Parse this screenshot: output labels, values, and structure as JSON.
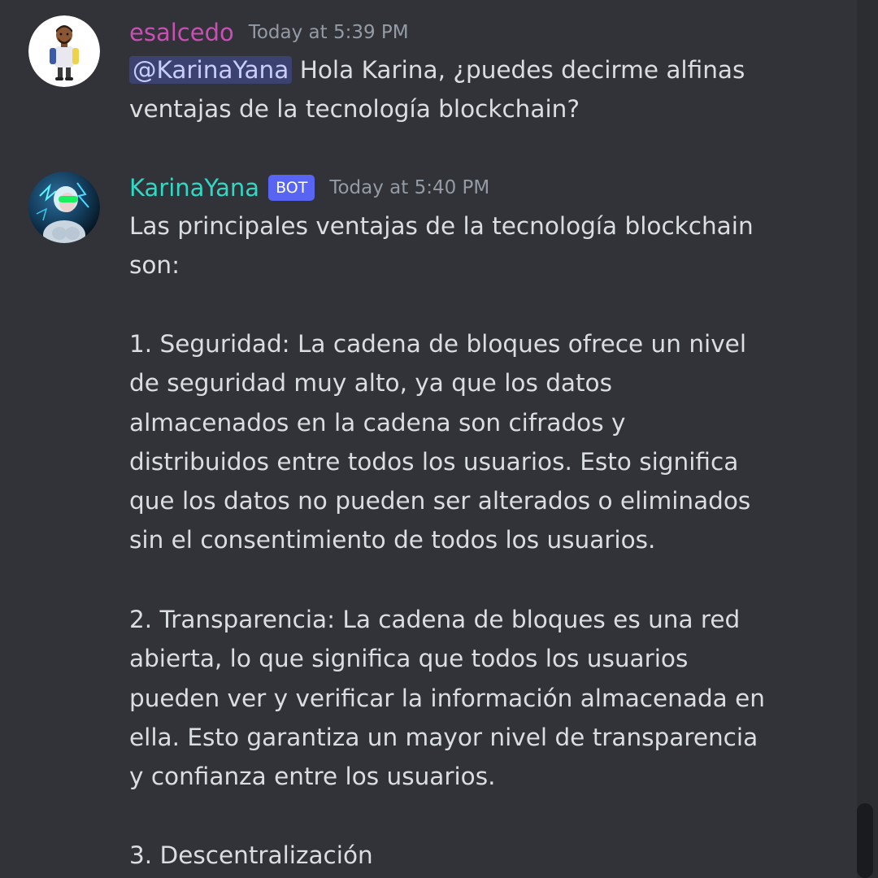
{
  "messages": [
    {
      "username": "esalcedo",
      "username_color": "#c94fb4",
      "timestamp": "Today at 5:39 PM",
      "mention": "@KarinaYana",
      "text": " Hola Karina, ¿puedes decirme alfinas ventajas de la tecnología blockchain?"
    },
    {
      "username": "KarinaYana",
      "username_color": "#2fd9c5",
      "bot_tag": "BOT",
      "timestamp": "Today at 5:40 PM",
      "paragraphs": [
        "Las principales ventajas de la tecnología blockchain son:",
        "1. Seguridad: La cadena de bloques ofrece un nivel de seguridad muy alto, ya que los datos almacenados en la cadena son cifrados y distribuidos entre todos los usuarios. Esto significa que los datos no pueden ser alterados o eliminados sin el consentimiento de todos los usuarios.",
        "2. Transparencia: La cadena de bloques es una red abierta, lo que significa que todos los usuarios pueden ver y verificar la información almacenada en ella. Esto garantiza un mayor nivel de transparencia y confianza entre los usuarios.",
        "3. Descentralización"
      ]
    }
  ],
  "colors": {
    "background": "#313338",
    "text": "#dbdee1",
    "timestamp": "#949ba4",
    "bot_tag": "#5865f2",
    "mention_bg": "#3c4270"
  }
}
